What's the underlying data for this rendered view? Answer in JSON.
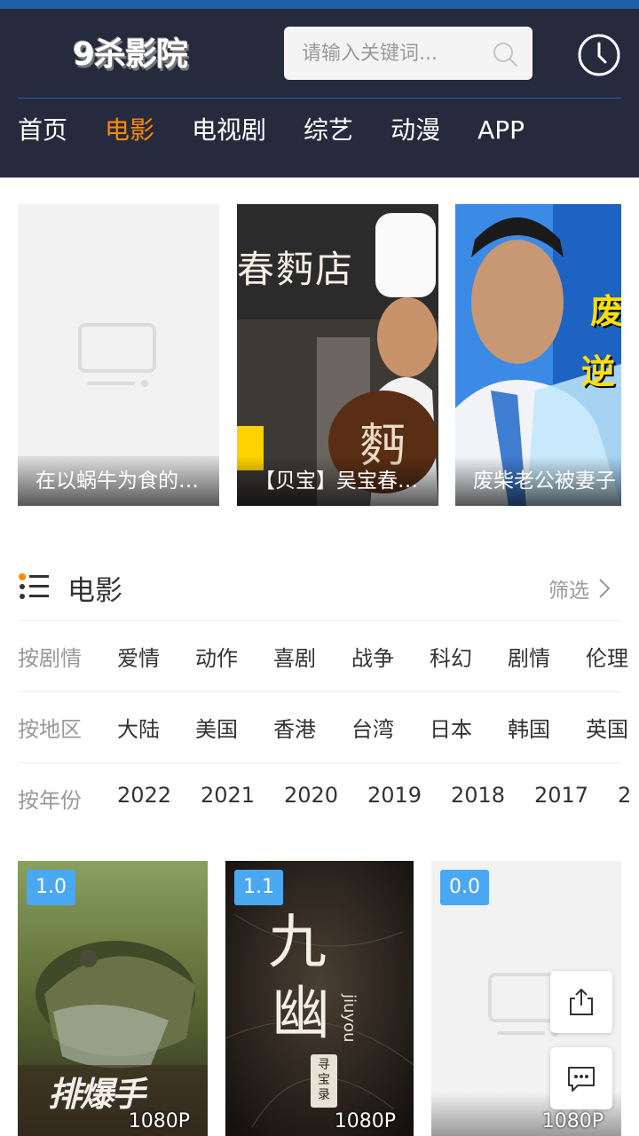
{
  "app": {
    "logo_text": "9杀影院"
  },
  "search": {
    "placeholder": "请输入关键词..."
  },
  "nav": {
    "items": [
      {
        "label": "首页",
        "active": false
      },
      {
        "label": "电影",
        "active": true
      },
      {
        "label": "电视剧",
        "active": false
      },
      {
        "label": "综艺",
        "active": false
      },
      {
        "label": "动漫",
        "active": false
      },
      {
        "label": "APP",
        "active": false
      }
    ]
  },
  "banners": [
    {
      "caption": "在以蜗牛为食的…"
    },
    {
      "caption": "【贝宝】吴宝春…",
      "sign_text": "春麪店",
      "bread_text": "麪"
    },
    {
      "caption": "废柴老公被妻子",
      "overlay_text": [
        "废",
        "逆"
      ]
    }
  ],
  "section": {
    "title": "电影",
    "filter_label": "筛选"
  },
  "filters": {
    "genre": {
      "label": "按剧情",
      "options": [
        "爱情",
        "动作",
        "喜剧",
        "战争",
        "科幻",
        "剧情",
        "伦理"
      ]
    },
    "region": {
      "label": "按地区",
      "options": [
        "大陆",
        "美国",
        "香港",
        "台湾",
        "日本",
        "韩国",
        "英国"
      ]
    },
    "year": {
      "label": "按年份",
      "options": [
        "2022",
        "2021",
        "2020",
        "2019",
        "2018",
        "2017",
        "2"
      ]
    }
  },
  "movies": [
    {
      "score": "1.0",
      "quality": "1080P",
      "poster_title": "排爆手"
    },
    {
      "score": "1.1",
      "quality": "1080P",
      "poster_title": "九幽",
      "poster_sub": "jiuyou",
      "poster_tag": "寻宝录"
    },
    {
      "score": "0.0",
      "quality": "1080P"
    }
  ],
  "colors": {
    "accent": "#ff8a00",
    "header_bg": "#262a3d",
    "score_badge": "#4aa8f2"
  }
}
